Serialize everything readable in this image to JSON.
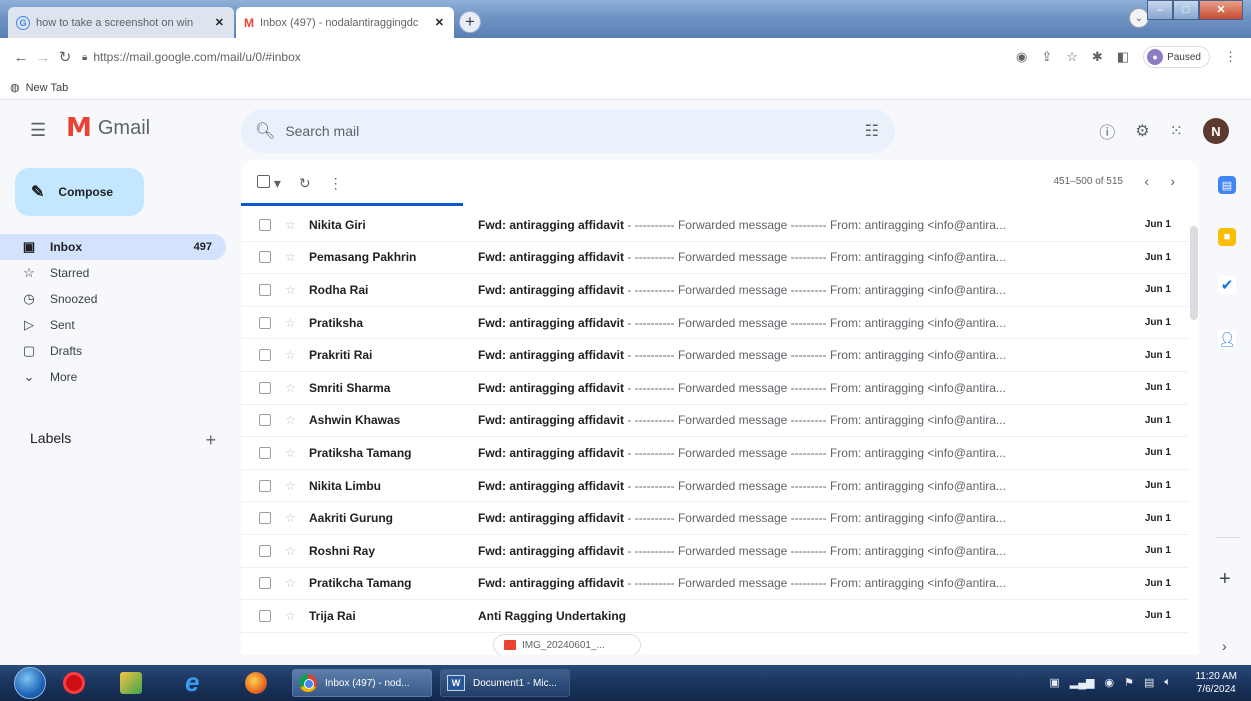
{
  "browser": {
    "tabs": [
      {
        "title": "how to take a screenshot on win",
        "close": "✕"
      },
      {
        "title": "Inbox (497) - nodalantiraggingdc",
        "close": "✕"
      }
    ],
    "new_tab": "+",
    "url": "https://mail.google.com/mail/u/0/#inbox",
    "profile_status": "Paused",
    "bookmark": "New Tab"
  },
  "gmail": {
    "logo_text": "Gmail",
    "search_placeholder": "Search mail",
    "account_initial": "N",
    "compose_label": "Compose",
    "nav": [
      {
        "label": "Inbox",
        "count": "497",
        "icon": "inbox-icon"
      },
      {
        "label": "Starred",
        "count": "",
        "icon": "star-icon"
      },
      {
        "label": "Snoozed",
        "count": "",
        "icon": "clock-icon"
      },
      {
        "label": "Sent",
        "count": "",
        "icon": "send-icon"
      },
      {
        "label": "Drafts",
        "count": "",
        "icon": "draft-icon"
      },
      {
        "label": "More",
        "count": "",
        "icon": "chevron-down-icon"
      }
    ],
    "labels_heading": "Labels",
    "pagination": "451–500 of 515",
    "emails": [
      {
        "sender": "Nikita Giri",
        "subject": "Fwd: antiragging affidavit",
        "snippet": " - ---------- Forwarded message --------- From: antiragging <info@antira...",
        "date": "Jun 1"
      },
      {
        "sender": "Pemasang Pakhrin",
        "subject": "Fwd: antiragging affidavit",
        "snippet": " - ---------- Forwarded message --------- From: antiragging <info@antira...",
        "date": "Jun 1"
      },
      {
        "sender": "Rodha Rai",
        "subject": "Fwd: antiragging affidavit",
        "snippet": " - ---------- Forwarded message --------- From: antiragging <info@antira...",
        "date": "Jun 1"
      },
      {
        "sender": "Pratiksha",
        "subject": "Fwd: antiragging affidavit",
        "snippet": " - ---------- Forwarded message --------- From: antiragging <info@antira...",
        "date": "Jun 1"
      },
      {
        "sender": "Prakriti Rai",
        "subject": "Fwd: antiragging affidavit",
        "snippet": " - ---------- Forwarded message --------- From: antiragging <info@antira...",
        "date": "Jun 1"
      },
      {
        "sender": "Smriti Sharma",
        "subject": "Fwd: antiragging affidavit",
        "snippet": " - ---------- Forwarded message --------- From: antiragging <info@antira...",
        "date": "Jun 1"
      },
      {
        "sender": "Ashwin Khawas",
        "subject": "Fwd: antiragging affidavit",
        "snippet": " - ---------- Forwarded message --------- From: antiragging <info@antira...",
        "date": "Jun 1"
      },
      {
        "sender": "Pratiksha Tamang",
        "subject": "Fwd: antiragging affidavit",
        "snippet": " - ---------- Forwarded message --------- From: antiragging <info@antira...",
        "date": "Jun 1"
      },
      {
        "sender": "Nikita Limbu",
        "subject": "Fwd: antiragging affidavit",
        "snippet": " - ---------- Forwarded message --------- From: antiragging <info@antira...",
        "date": "Jun 1"
      },
      {
        "sender": "Aakriti Gurung",
        "subject": "Fwd: antiragging affidavit",
        "snippet": " - ---------- Forwarded message --------- From: antiragging <info@antira...",
        "date": "Jun 1"
      },
      {
        "sender": "Roshni Ray",
        "subject": "Fwd: antiragging affidavit",
        "snippet": " - ---------- Forwarded message --------- From: antiragging <info@antira...",
        "date": "Jun 1"
      },
      {
        "sender": "Pratikcha Tamang",
        "subject": "Fwd: antiragging affidavit",
        "snippet": " - ---------- Forwarded message --------- From: antiragging <info@antira...",
        "date": "Jun 1"
      },
      {
        "sender": "Trija Rai",
        "subject": "Anti Ragging Undertaking",
        "snippet": "",
        "date": "Jun 1"
      }
    ],
    "attachment_name": "IMG_20240601_..."
  },
  "taskbar": {
    "tasks": [
      "Inbox (497) - nod...",
      "Document1 - Mic..."
    ],
    "time": "11:20 AM",
    "date": "7/6/2024"
  }
}
